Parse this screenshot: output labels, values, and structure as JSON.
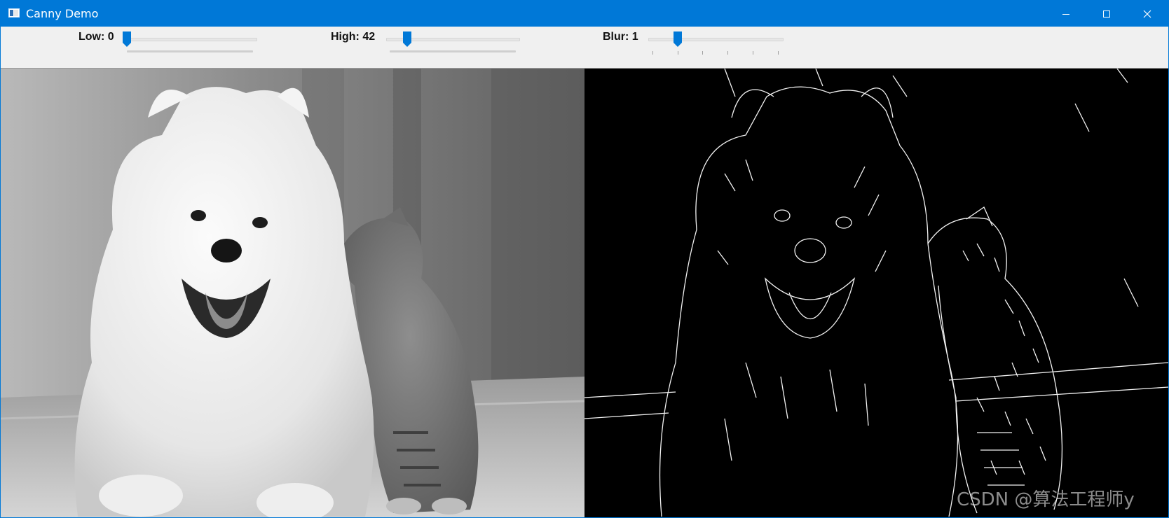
{
  "window": {
    "title": "Canny Demo",
    "icons": {
      "app": "app-window-icon",
      "minimize": "minimize-icon",
      "maximize": "maximize-icon",
      "close": "close-icon"
    },
    "colors": {
      "titlebar": "#0078d7",
      "toolbar": "#f0f0f0",
      "thumb": "#0078d7"
    }
  },
  "trackbars": [
    {
      "label": "Low: 0",
      "value": 0
    },
    {
      "label": "High: 42",
      "value": 42
    },
    {
      "label": "Blur: 1",
      "value": 1
    }
  ],
  "panes": {
    "left": {
      "description_icon": "grayscale-photo-dog-and-cat"
    },
    "right": {
      "description_icon": "canny-edge-map"
    }
  },
  "watermark": "CSDN @算法工程师y"
}
